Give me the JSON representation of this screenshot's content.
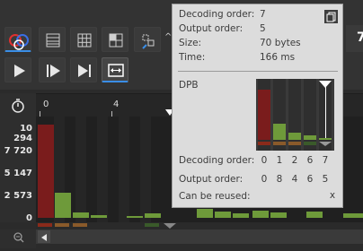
{
  "toolbar": {
    "zoom_char": "7",
    "chevron_glyph": "^"
  },
  "timeline": {
    "ruler_labels": [
      "0",
      "4"
    ],
    "y_ticks": [
      "10 294",
      "7 720",
      "5 147",
      "2 573",
      "0"
    ]
  },
  "tooltip": {
    "decoding_order_label": "Decoding order:",
    "decoding_order_value": "7",
    "output_order_label": "Output order:",
    "output_order_value": "5",
    "size_label": "Size:",
    "size_value": "70 bytes",
    "time_label": "Time:",
    "time_value": "166 ms",
    "dpb_label": "DPB",
    "dpb_decoding_label": "Decoding order:",
    "dpb_decoding_values": [
      "0",
      "1",
      "2",
      "6",
      "7"
    ],
    "dpb_output_label": "Output order:",
    "dpb_output_values": [
      "0",
      "8",
      "4",
      "6",
      "5"
    ],
    "reuse_label": "Can be reused:",
    "reuse_value": "x"
  },
  "colors": {
    "i_frame": "#7a1c1c",
    "p_frame": "#6e9a3a",
    "accent": "#3a8ee6"
  }
}
